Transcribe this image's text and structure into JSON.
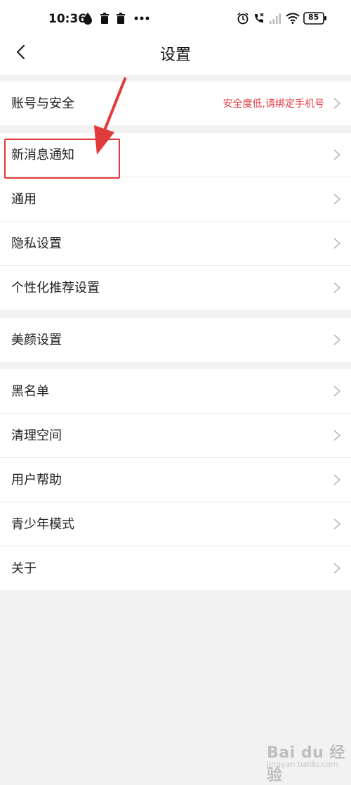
{
  "status_bar": {
    "time": "10:36",
    "battery": "85",
    "icons": [
      "drop-icon",
      "trash-icon",
      "trash-icon",
      "more-dots-icon",
      "alarm-icon",
      "call-missed-icon",
      "signal-icon",
      "wifi-icon",
      "battery-icon"
    ]
  },
  "header": {
    "title": "设置",
    "back_icon": "chevron-left-icon"
  },
  "groups": [
    {
      "items": [
        {
          "label": "账号与安全",
          "sub": "安全度低,请绑定手机号"
        }
      ]
    },
    {
      "items": [
        {
          "label": "新消息通知"
        },
        {
          "label": "通用"
        },
        {
          "label": "隐私设置"
        },
        {
          "label": "个性化推荐设置"
        }
      ]
    },
    {
      "items": [
        {
          "label": "美颜设置"
        }
      ]
    },
    {
      "items": [
        {
          "label": "黑名单"
        },
        {
          "label": "清理空间"
        },
        {
          "label": "用户帮助"
        },
        {
          "label": "青少年模式"
        },
        {
          "label": "关于"
        }
      ]
    }
  ],
  "annotation": {
    "color": "#e03a3a"
  },
  "watermark": {
    "text": "Bai du 经验",
    "url": "jingyan.baidu.com"
  },
  "colors": {
    "warning": "#e0444a",
    "background": "#f2f2f2"
  }
}
